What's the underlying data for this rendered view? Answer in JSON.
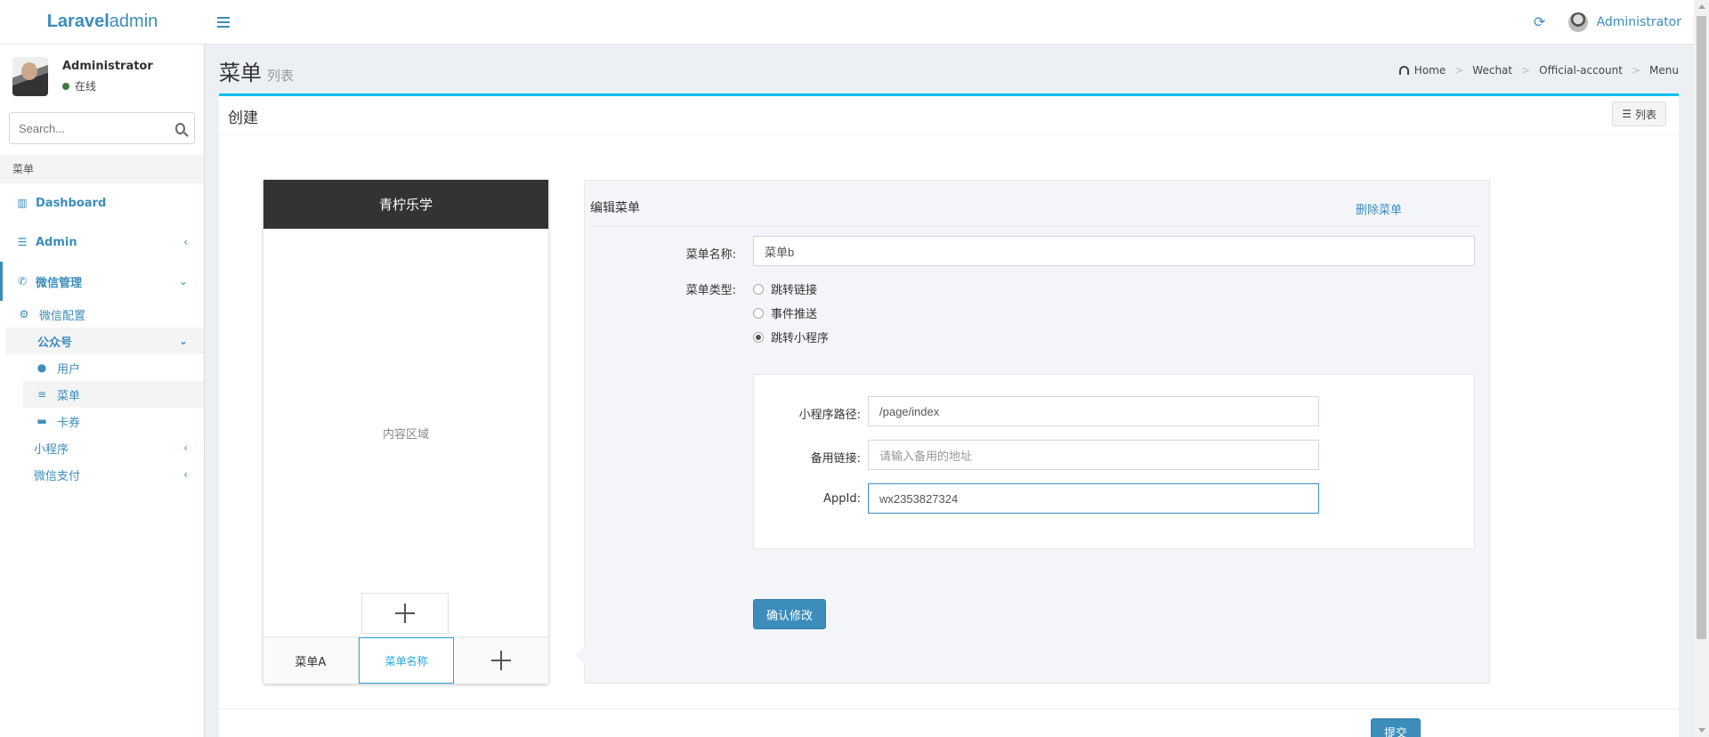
{
  "header": {
    "logo_bold": "Laravel",
    "logo_rest": " admin",
    "user_name": "Administrator"
  },
  "sidebar": {
    "user_name": "Administrator",
    "status": "在线",
    "search_placeholder": "Search...",
    "section_header": "菜单",
    "items": {
      "dashboard": "Dashboard",
      "admin": "Admin",
      "wechat": "微信管理",
      "wechat_config": "微信配置",
      "official": "公众号",
      "users": "用户",
      "menu": "菜单",
      "cards": "卡券",
      "mini_program": "小程序",
      "wechat_pay": "微信支付"
    }
  },
  "content": {
    "title": "菜单",
    "subtitle": "列表",
    "breadcrumb": [
      "Home",
      "Wechat",
      "Official-account",
      "Menu"
    ]
  },
  "box": {
    "title": "创建",
    "list_button": "列表",
    "submit": "提交"
  },
  "phone": {
    "title": "青柠乐学",
    "content_area": "内容区域",
    "menu_tabs": [
      "菜单A",
      "菜单名称"
    ]
  },
  "editor": {
    "title": "编辑菜单",
    "delete_link": "删除菜单",
    "name_label": "菜单名称:",
    "name_value": "菜单b",
    "type_label": "菜单类型:",
    "type_options": [
      "跳转链接",
      "事件推送",
      "跳转小程序"
    ],
    "selected_type": "跳转小程序",
    "path_label": "小程序路径:",
    "path_value": "/page/index",
    "backup_label": "备用链接:",
    "backup_placeholder": "请输入备用的地址",
    "appid_label": "AppId:",
    "appid_value": "wx2353827324",
    "confirm_button": "确认修改"
  }
}
